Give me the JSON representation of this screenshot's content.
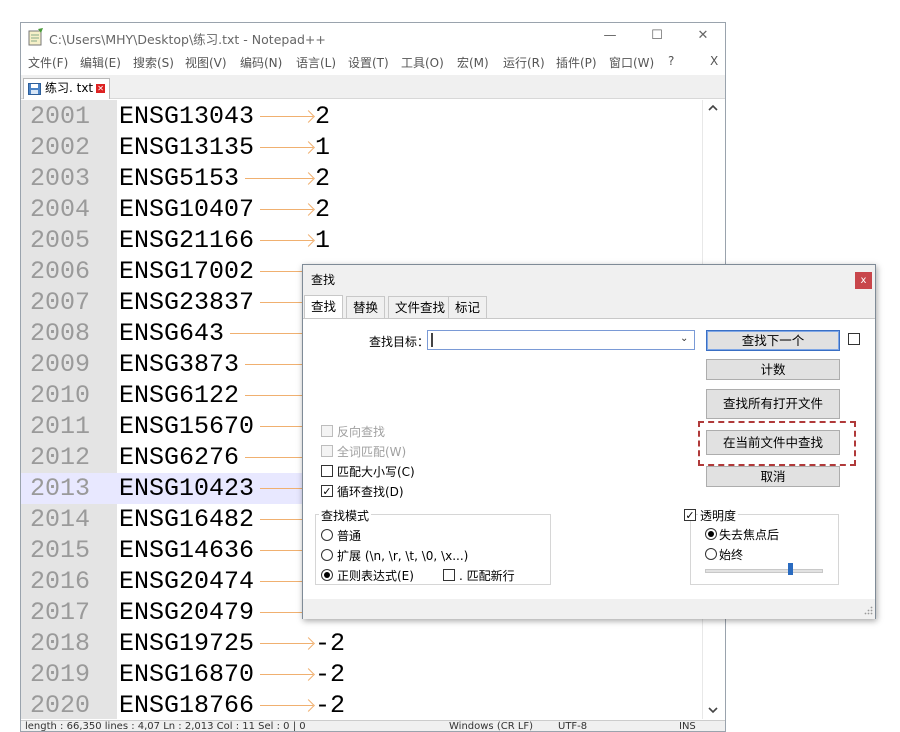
{
  "window": {
    "title": "C:\\Users\\MHY\\Desktop\\练习.txt - Notepad++",
    "minimize": "—",
    "maximize": "☐",
    "close": "✕"
  },
  "menu": [
    "文件(F)",
    "编辑(E)",
    "搜索(S)",
    "视图(V)",
    "编码(N)",
    "语言(L)",
    "设置(T)",
    "工具(O)",
    "宏(M)",
    "运行(R)",
    "插件(P)",
    "窗口(W)",
    "?",
    "X"
  ],
  "tab": {
    "label": "练习. txt",
    "close": "✕"
  },
  "lines": [
    {
      "num": "2001",
      "gene": "ENSG13043",
      "value": "2"
    },
    {
      "num": "2002",
      "gene": "ENSG13135",
      "value": "1"
    },
    {
      "num": "2003",
      "gene": "ENSG5153",
      "value": "2"
    },
    {
      "num": "2004",
      "gene": "ENSG10407",
      "value": "2"
    },
    {
      "num": "2005",
      "gene": "ENSG21166",
      "value": "1"
    },
    {
      "num": "2006",
      "gene": "ENSG17002",
      "value": ""
    },
    {
      "num": "2007",
      "gene": "ENSG23837",
      "value": ""
    },
    {
      "num": "2008",
      "gene": "ENSG643",
      "value": ""
    },
    {
      "num": "2009",
      "gene": "ENSG3873",
      "value": ""
    },
    {
      "num": "2010",
      "gene": "ENSG6122",
      "value": ""
    },
    {
      "num": "2011",
      "gene": "ENSG15670",
      "value": ""
    },
    {
      "num": "2012",
      "gene": "ENSG6276",
      "value": ""
    },
    {
      "num": "2013",
      "gene": "ENSG10423",
      "value": ""
    },
    {
      "num": "2014",
      "gene": "ENSG16482",
      "value": ""
    },
    {
      "num": "2015",
      "gene": "ENSG14636",
      "value": ""
    },
    {
      "num": "2016",
      "gene": "ENSG20474",
      "value": ""
    },
    {
      "num": "2017",
      "gene": "ENSG20479",
      "value": ""
    },
    {
      "num": "2018",
      "gene": "ENSG19725",
      "value": "-2"
    },
    {
      "num": "2019",
      "gene": "ENSG16870",
      "value": "-2"
    },
    {
      "num": "2020",
      "gene": "ENSG18766",
      "value": "-2"
    }
  ],
  "statusbar": {
    "left": "length : 66,350    lines : 4,07    Ln : 2,013    Col : 11    Sel : 0 | 0",
    "eol": "Windows (CR LF)",
    "encoding": "UTF-8",
    "mode": "INS"
  },
  "dialog": {
    "title": "查找",
    "close": "x",
    "tabs": [
      "查找",
      "替换",
      "文件查找",
      "标记"
    ],
    "find_label": "查找目标：",
    "find_value": "",
    "buttons": {
      "find_next": "查找下一个",
      "count": "计数",
      "find_all_open": "查找所有打开文件",
      "find_all_current": "在当前文件中查找",
      "cancel": "取消"
    },
    "options": {
      "backward": "反向查找",
      "whole_word": "全词匹配(W)",
      "match_case": "匹配大小写(C)",
      "wrap": "循环查找(D)"
    },
    "search_mode": {
      "title": "查找模式",
      "normal": "普通",
      "extended": "扩展 (\\n, \\r, \\t, \\0, \\x...)",
      "regex": "正则表达式(E)",
      "dot_newline": ". 匹配新行"
    },
    "transparency": {
      "title": "透明度",
      "on_lose_focus": "失去焦点后",
      "always": "始终",
      "level": 0.72
    }
  }
}
